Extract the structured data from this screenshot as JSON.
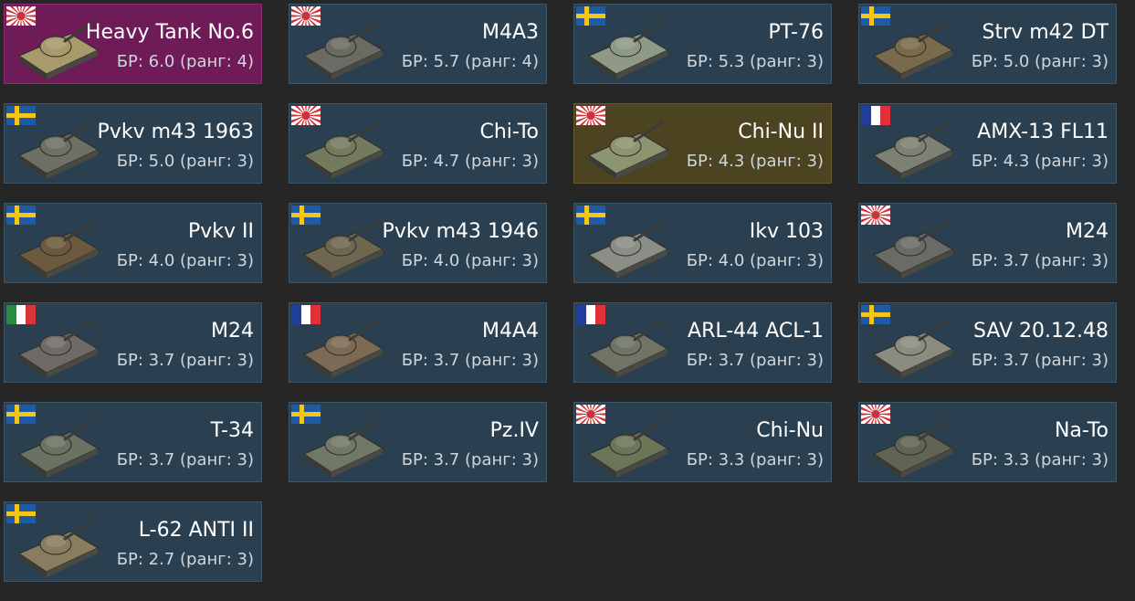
{
  "vehicles": [
    {
      "name": "Heavy Tank No.6",
      "br": "БР: 6.0 (ранг: 4)",
      "flag": "japan",
      "style": "premium",
      "tank_color": "#a89a6a"
    },
    {
      "name": "M4A3",
      "br": "БР: 5.7 (ранг: 4)",
      "flag": "japan",
      "style": "normal",
      "tank_color": "#6b6b63"
    },
    {
      "name": "PT-76",
      "br": "БР: 5.3 (ранг: 3)",
      "flag": "sweden",
      "style": "normal",
      "tank_color": "#8f9a86"
    },
    {
      "name": "Strv m42 DT",
      "br": "БР: 5.0 (ранг: 3)",
      "flag": "sweden",
      "style": "normal",
      "tank_color": "#7a6a4c"
    },
    {
      "name": "Pvkv m43 1963",
      "br": "БР: 5.0 (ранг: 3)",
      "flag": "sweden",
      "style": "normal",
      "tank_color": "#6e7065"
    },
    {
      "name": "Chi-To",
      "br": "БР: 4.7 (ранг: 3)",
      "flag": "japan",
      "style": "normal",
      "tank_color": "#737a5e"
    },
    {
      "name": "Chi-Nu II",
      "br": "БР: 4.3 (ранг: 3)",
      "flag": "japan",
      "style": "highlight",
      "tank_color": "#8d9470"
    },
    {
      "name": "AMX-13 FL11",
      "br": "БР: 4.3 (ранг: 3)",
      "flag": "france",
      "style": "normal",
      "tank_color": "#7d8173"
    },
    {
      "name": "Pvkv II",
      "br": "БР: 4.0 (ранг: 3)",
      "flag": "sweden",
      "style": "normal",
      "tank_color": "#6d5a3e"
    },
    {
      "name": "Pvkv m43 1946",
      "br": "БР: 4.0 (ранг: 3)",
      "flag": "sweden",
      "style": "normal",
      "tank_color": "#6f6650"
    },
    {
      "name": "Ikv 103",
      "br": "БР: 4.0 (ранг: 3)",
      "flag": "sweden",
      "style": "normal",
      "tank_color": "#8a8e86"
    },
    {
      "name": "M24",
      "br": "БР: 3.7 (ранг: 3)",
      "flag": "japan",
      "style": "normal",
      "tank_color": "#6a6a66"
    },
    {
      "name": "M24",
      "br": "БР: 3.7 (ранг: 3)",
      "flag": "italy",
      "style": "normal",
      "tank_color": "#6f6a65"
    },
    {
      "name": "M4A4",
      "br": "БР: 3.7 (ранг: 3)",
      "flag": "france",
      "style": "normal",
      "tank_color": "#7c6a55"
    },
    {
      "name": "ARL-44 ACL-1",
      "br": "БР: 3.7 (ранг: 3)",
      "flag": "france",
      "style": "normal",
      "tank_color": "#6f7465"
    },
    {
      "name": "SAV 20.12.48",
      "br": "БР: 3.7 (ранг: 3)",
      "flag": "sweden",
      "style": "normal",
      "tank_color": "#8a8c80"
    },
    {
      "name": "T-34",
      "br": "БР: 3.7 (ранг: 3)",
      "flag": "sweden",
      "style": "normal",
      "tank_color": "#6a7262"
    },
    {
      "name": "Pz.IV",
      "br": "БР: 3.7 (ранг: 3)",
      "flag": "sweden",
      "style": "normal",
      "tank_color": "#717866"
    },
    {
      "name": "Chi-Nu",
      "br": "БР: 3.3 (ранг: 3)",
      "flag": "japan",
      "style": "normal",
      "tank_color": "#6d7559"
    },
    {
      "name": "Na-To",
      "br": "БР: 3.3 (ранг: 3)",
      "flag": "japan",
      "style": "normal",
      "tank_color": "#5f6552"
    },
    {
      "name": "L-62 ANTI II",
      "br": "БР: 2.7 (ранг: 3)",
      "flag": "sweden",
      "style": "normal",
      "tank_color": "#8a7c5e"
    }
  ]
}
